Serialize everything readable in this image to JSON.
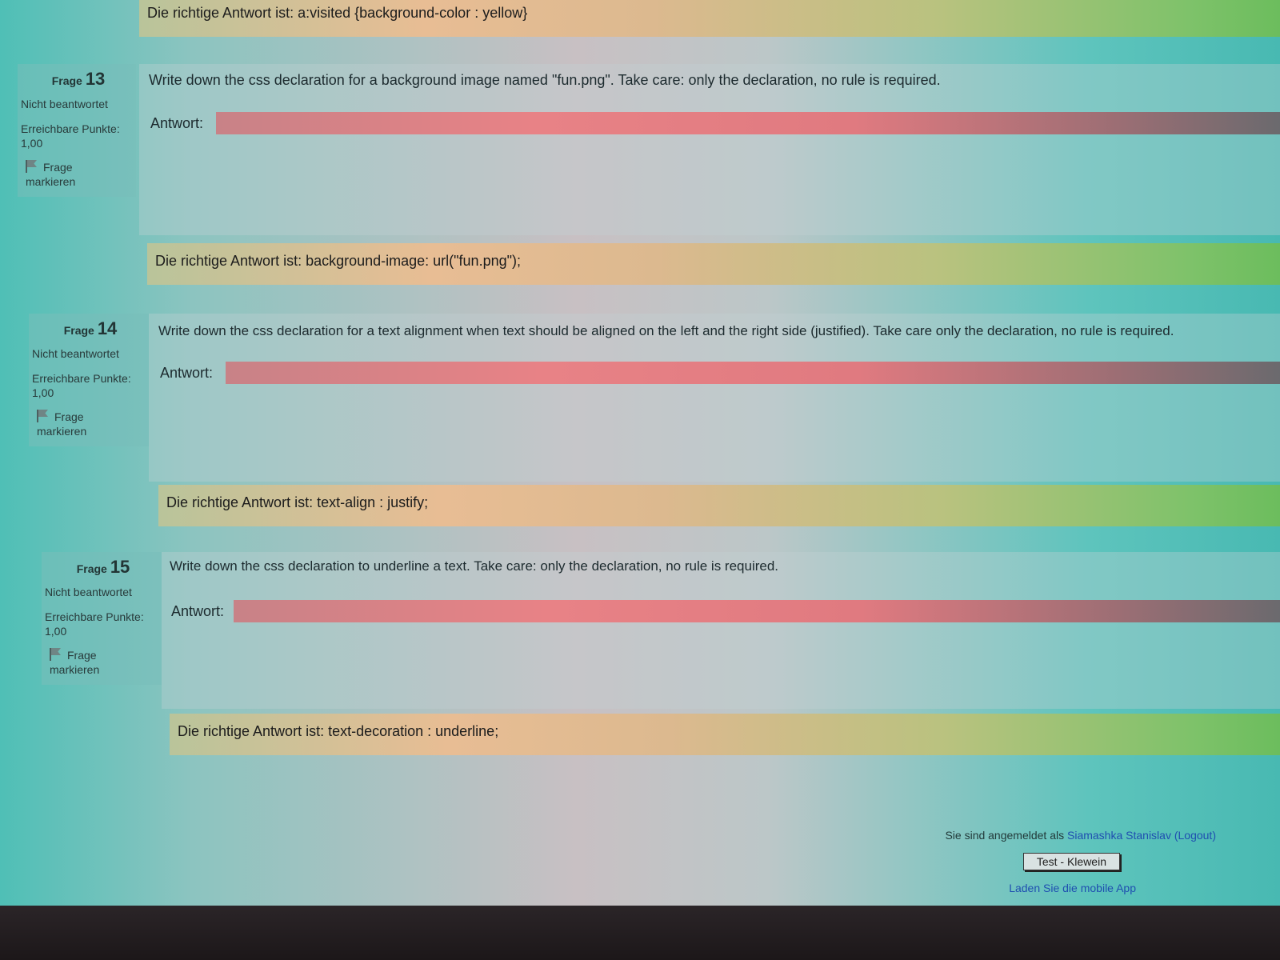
{
  "top_feedback": "Die richtige Antwort ist: a:visited {background-color : yellow}",
  "questions": [
    {
      "label": "Frage",
      "number": "13",
      "state": "Nicht beantwortet",
      "points_label": "Erreichbare Punkte:",
      "points_value": "1,00",
      "flag_line1": "Frage",
      "flag_line2": "markieren",
      "text": "Write down the css declaration for a background image named \"fun.png\". Take care: only the declaration, no rule is required.",
      "answer_label": "Antwort:",
      "answer_value": "",
      "feedback": "Die richtige Antwort ist: background-image: url(\"fun.png\");"
    },
    {
      "label": "Frage",
      "number": "14",
      "state": "Nicht beantwortet",
      "points_label": "Erreichbare Punkte:",
      "points_value": "1,00",
      "flag_line1": "Frage",
      "flag_line2": "markieren",
      "text": "Write down the css declaration for a text alignment when text should be aligned on the left and the right side (justified). Take care only the declaration, no rule is required.",
      "answer_label": "Antwort:",
      "answer_value": "",
      "feedback": "Die richtige Antwort ist: text-align : justify;"
    },
    {
      "label": "Frage",
      "number": "15",
      "state": "Nicht beantwortet",
      "points_label": "Erreichbare Punkte:",
      "points_value": "1,00",
      "flag_line1": "Frage",
      "flag_line2": "markieren",
      "text": "Write down the css declaration to underline a text. Take care: only the declaration, no rule is required.",
      "answer_label": "Antwort:",
      "answer_value": "",
      "feedback": "Die richtige Antwort ist: text-decoration : underline;"
    }
  ],
  "footer": {
    "logged_in_prefix": "Sie sind angemeldet als",
    "user_name": "Siamashka Stanislav",
    "logout": "(Logout)",
    "course_button": "Test - Klewein",
    "mobile_app": "Laden Sie die mobile App"
  },
  "colors": {
    "feedback_bg": "#e3bf92",
    "answer_incorrect": "#e88286",
    "link": "#1f4fb0"
  }
}
